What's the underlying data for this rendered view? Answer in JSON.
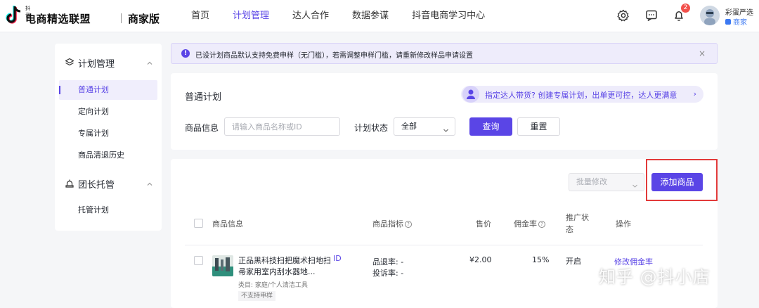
{
  "brand": {
    "small_text": "抖音",
    "main_text": "电商精选联盟",
    "suffix": "商家版"
  },
  "nav": [
    {
      "label": "首页"
    },
    {
      "label": "计划管理"
    },
    {
      "label": "达人合作"
    },
    {
      "label": "数据参谋"
    },
    {
      "label": "抖音电商学习中心"
    }
  ],
  "nav_active": "计划管理",
  "notifications": {
    "count": "2"
  },
  "user": {
    "name": "彩蛋严选",
    "role": "商家"
  },
  "sidebar": {
    "groups": [
      {
        "label": "计划管理",
        "icon": "layers-icon",
        "items": [
          "普通计划",
          "定向计划",
          "专属计划",
          "商品清退历史"
        ]
      },
      {
        "label": "团长托管",
        "icon": "handshake-icon",
        "items": [
          "托管计划"
        ]
      }
    ],
    "active_item": "普通计划"
  },
  "notice": {
    "text": "已设计划商品默认支持免费申样（无门槛），若需调整申样门槛，请重新修改样品申请设置",
    "close": "×"
  },
  "plan": {
    "title": "普通计划",
    "promo": "指定达人带货? 创建专属计划，出单更可控，达人更满意",
    "promo_arrow": "›",
    "filters": {
      "product_label": "商品信息",
      "product_placeholder": "请输入商品名称或ID",
      "status_label": "计划状态",
      "status_value": "全部"
    },
    "query_button": "查询",
    "reset_button": "重置"
  },
  "list": {
    "batch_edit": "批量修改",
    "add_button": "添加商品",
    "columns": {
      "product": "商品信息",
      "metrics": "商品指标",
      "price": "售价",
      "commission": "佣金率",
      "status_line1": "推广状",
      "status_line2": "态",
      "action": "操作"
    },
    "rows": [
      {
        "name": "正品黑科技扫把魔术扫地扫帚家用室内刮水器地...",
        "id": "ID",
        "category": "类目: 家庭/个人清洁工具",
        "tag": "不支持申样",
        "refund_rate": "品退率: -",
        "complaint_rate": "投诉率: -",
        "price": "¥2.00",
        "commission": "15%",
        "status": "开启",
        "action": "修改佣金率"
      }
    ]
  },
  "watermark": "知乎 @抖小店",
  "colors": {
    "accent": "#5a45e6",
    "highlight_border": "#e23a3a",
    "badge": "#f2504b"
  }
}
